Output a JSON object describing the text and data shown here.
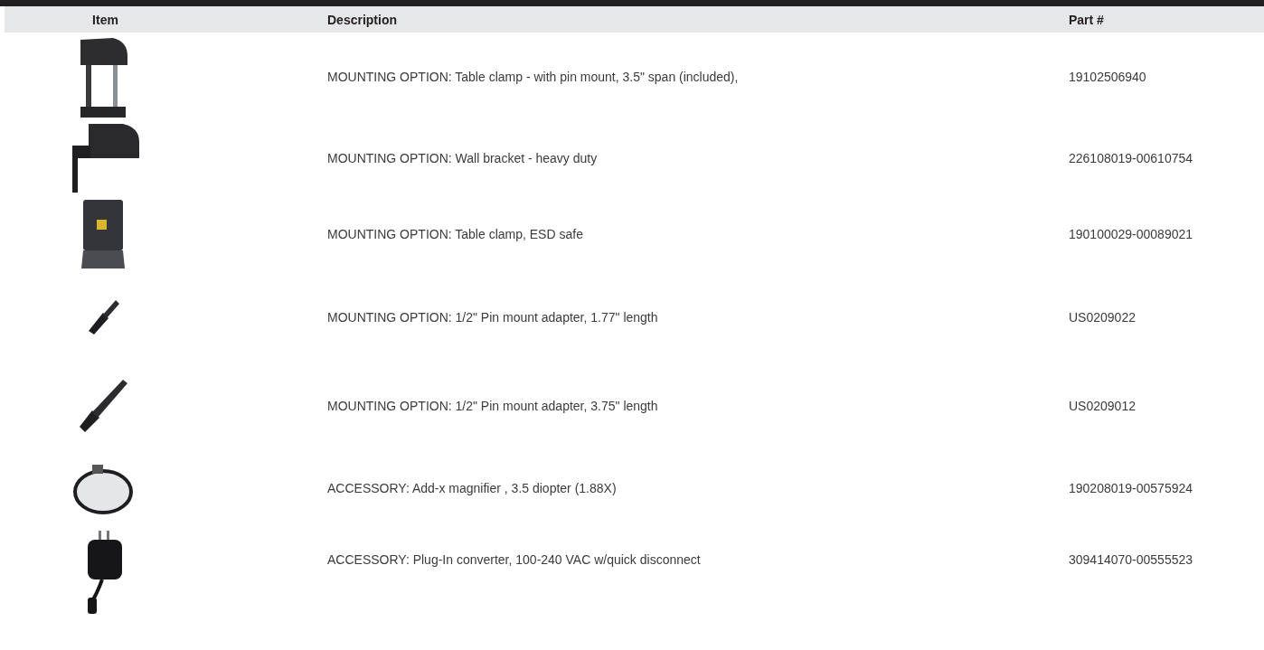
{
  "table": {
    "columns": [
      "Item",
      "Description",
      "Part #"
    ],
    "rows": [
      {
        "kind": "clamp",
        "description": "MOUNTING OPTION: Table clamp - with pin mount, 3.5\" span (included),",
        "part": "19102506940"
      },
      {
        "kind": "bracket",
        "description": "MOUNTING OPTION: Wall bracket - heavy duty",
        "part": "226108019-00610754"
      },
      {
        "kind": "plate",
        "description": "MOUNTING OPTION: Table clamp, ESD safe",
        "part": "190100029-00089021"
      },
      {
        "kind": "pin-short",
        "description": "MOUNTING OPTION: 1/2\" Pin mount adapter, 1.77\" length",
        "part": "US0209022"
      },
      {
        "kind": "pin-long",
        "description": "MOUNTING OPTION: 1/2\" Pin mount adapter, 3.75\" length",
        "part": "US0209012"
      },
      {
        "kind": "magnifier",
        "description": "ACCESSORY: Add-x magnifier , 3.5 diopter (1.88X)",
        "part": "190208019-00575924"
      },
      {
        "kind": "adapter",
        "description": "ACCESSORY: Plug-In converter, 100-240 VAC w/quick disconnect",
        "part": "309414070-00555523"
      }
    ]
  }
}
